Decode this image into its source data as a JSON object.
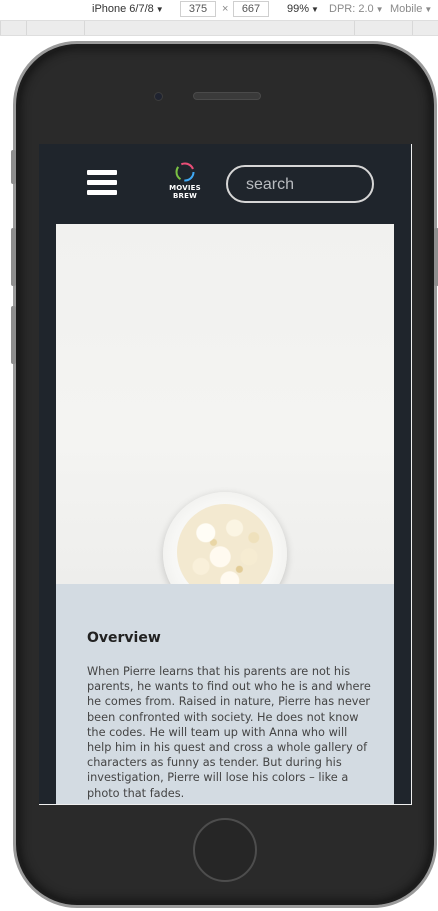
{
  "devtools": {
    "device": "iPhone 6/7/8",
    "width": "375",
    "times": "×",
    "height": "667",
    "zoom": "99%",
    "dpr": "DPR: 2.0",
    "mode": "Mobile"
  },
  "site": {
    "logo_line1": "MOVIES",
    "logo_line2": "BREW",
    "search_placeholder": "search"
  },
  "overview": {
    "heading": "Overview",
    "body": "When Pierre learns that his parents are not his parents, he wants to find out who he is and where he comes from. Raised in nature, Pierre has never been confronted with society. He does not know the codes. He will team up with Anna who will help him in his quest and cross a whole gallery of characters as funny as tender. But during his investigation, Pierre will lose his colors – like a photo that fades."
  },
  "colors": {
    "header_bg": "#1f252c",
    "overview_bg": "#d3dbe2"
  },
  "icons": [
    "hamburger-menu-icon",
    "movies-brew-logo-icon"
  ]
}
